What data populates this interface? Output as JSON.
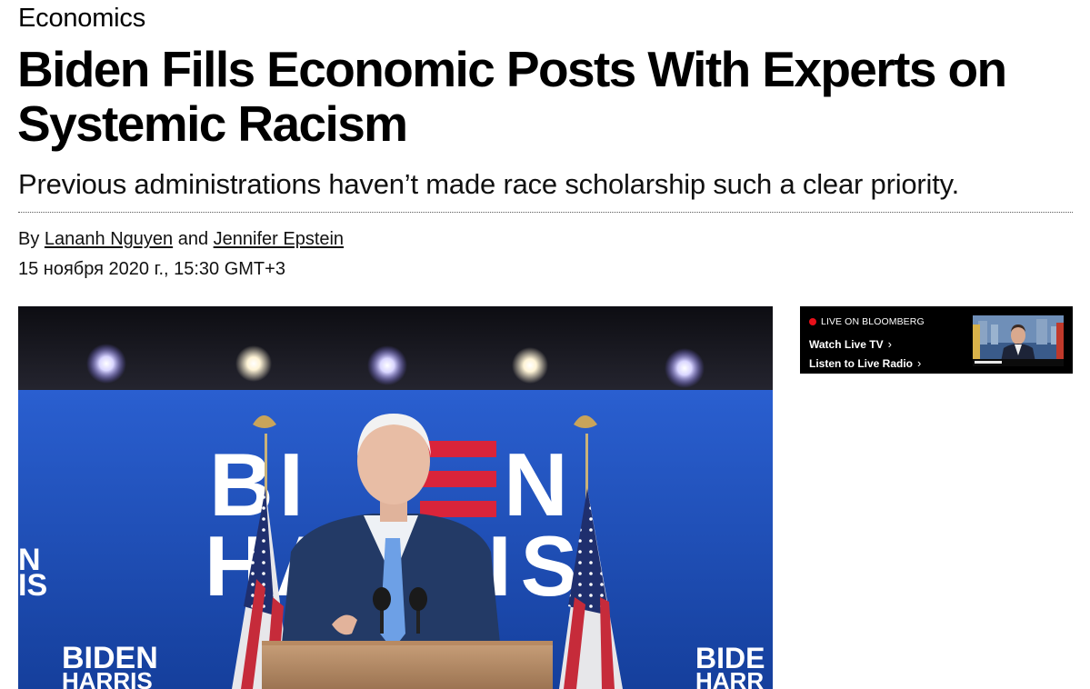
{
  "article": {
    "section": "Economics",
    "headline": "Biden Fills Economic Posts With Experts on Systemic Racism",
    "dek": "Previous administrations haven’t made race scholarship such a clear priority.",
    "byline_prefix": "By",
    "authors": [
      "Lananh Nguyen",
      "Jennifer Epstein"
    ],
    "byline_conjunction": "and",
    "timestamp": "15 ноября 2020 г., 15:30 GMT+3"
  },
  "hero_image": {
    "backdrop_texts": [
      "BIDEN",
      "HARRIS"
    ],
    "colors": {
      "backdrop_blue": "#1f4fb8",
      "stripe_red": "#d9243a",
      "text_white": "#ffffff"
    }
  },
  "live_widget": {
    "label": "LIVE ON BLOOMBERG",
    "watch_label": "Watch Live TV",
    "listen_label": "Listen to Live Radio",
    "chevron": "›",
    "colors": {
      "background": "#000000",
      "live_dot": "#e8101a"
    }
  }
}
